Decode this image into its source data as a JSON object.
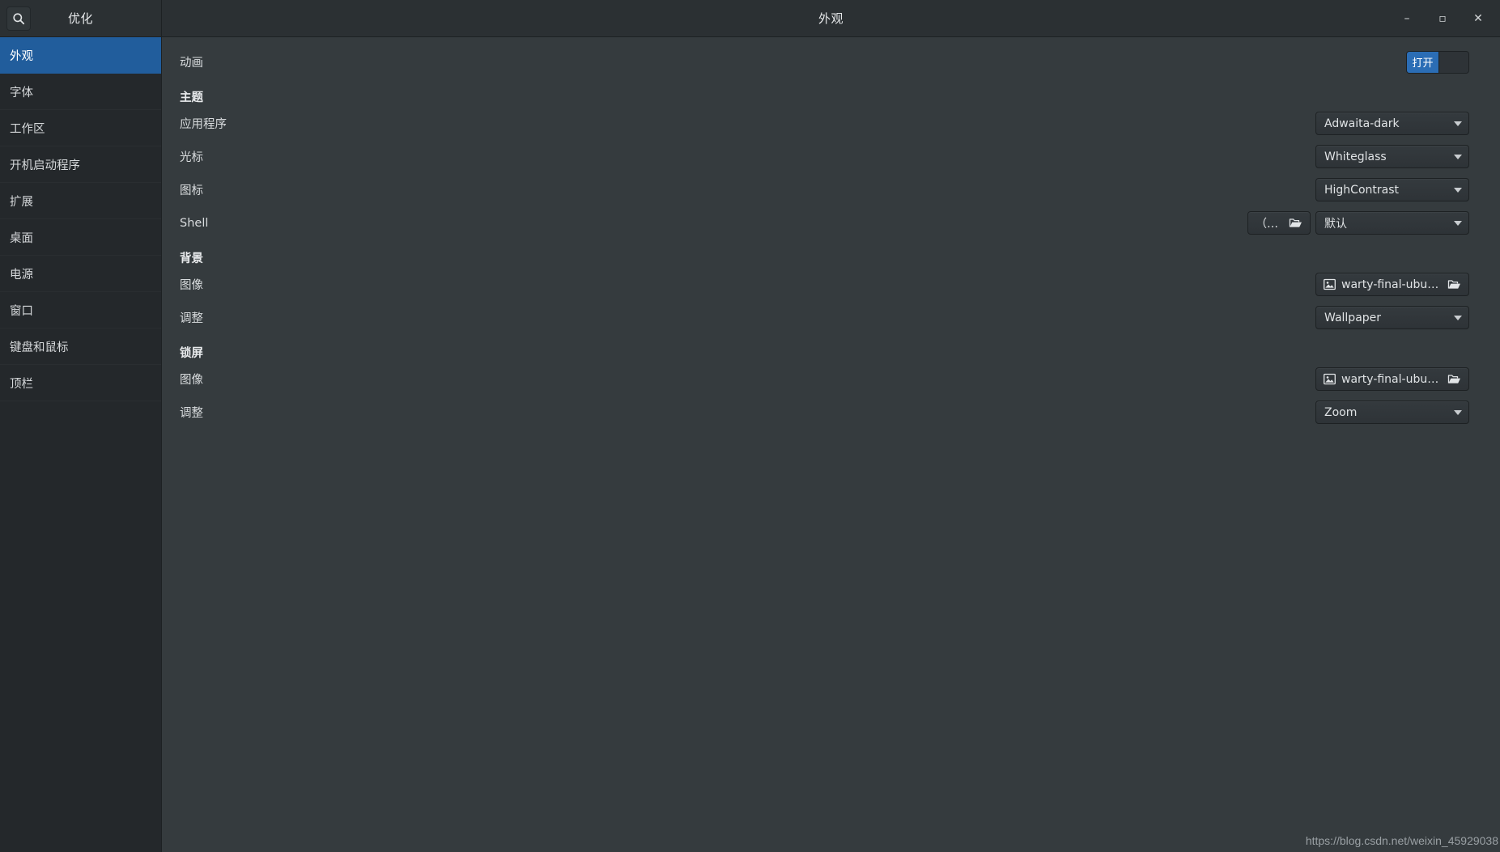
{
  "window": {
    "app_title": "优化",
    "title": "外观",
    "controls": {
      "minimize": "–",
      "maximize": "▫",
      "close": "✕"
    },
    "search_icon": "search-icon"
  },
  "sidebar": {
    "items": [
      {
        "label": "外观",
        "selected": true
      },
      {
        "label": "字体",
        "selected": false
      },
      {
        "label": "工作区",
        "selected": false
      },
      {
        "label": "开机启动程序",
        "selected": false
      },
      {
        "label": "扩展",
        "selected": false
      },
      {
        "label": "桌面",
        "selected": false
      },
      {
        "label": "电源",
        "selected": false
      },
      {
        "label": "窗口",
        "selected": false
      },
      {
        "label": "键盘和鼠标",
        "selected": false
      },
      {
        "label": "顶栏",
        "selected": false
      }
    ]
  },
  "content": {
    "animation": {
      "label": "动画",
      "switch_on_label": "打开",
      "switch_state": "on"
    },
    "theme_section": {
      "label": "主题"
    },
    "theme": {
      "application": {
        "label": "应用程序",
        "value": "Adwaita-dark"
      },
      "cursor": {
        "label": "光标",
        "value": "Whiteglass"
      },
      "icons": {
        "label": "图标",
        "value": "HighContrast"
      },
      "shell": {
        "label": "Shell",
        "file_button_value": "（无）",
        "value": "默认"
      }
    },
    "background_section": {
      "label": "背景"
    },
    "background": {
      "image": {
        "label": "图像",
        "value": "warty-final-ubuntu.png"
      },
      "adjust": {
        "label": "调整",
        "value": "Wallpaper"
      }
    },
    "lockscreen_section": {
      "label": "锁屏"
    },
    "lockscreen": {
      "image": {
        "label": "图像",
        "value": "warty-final-ubuntu.png"
      },
      "adjust": {
        "label": "调整",
        "value": "Zoom"
      }
    }
  },
  "watermark": {
    "text": "https://blog.csdn.net/weixin_45929038"
  },
  "colors": {
    "accent": "#215d9c",
    "switch_on": "#2b6db5",
    "sidebar_bg": "#24282b",
    "content_bg": "#353b3e",
    "header_bg": "#2b3033"
  }
}
